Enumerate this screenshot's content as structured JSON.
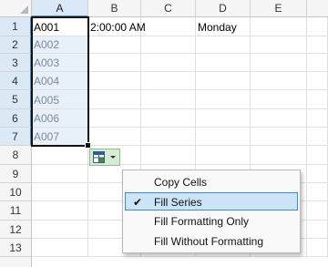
{
  "columns": [
    "A",
    "B",
    "C",
    "D",
    "E"
  ],
  "rows": [
    "1",
    "2",
    "3",
    "4",
    "5",
    "6",
    "7",
    "8",
    "9",
    "10",
    "11",
    "12",
    "13"
  ],
  "cells": {
    "a1": "A001",
    "a2": "A002",
    "a3": "A003",
    "a4": "A004",
    "a5": "A005",
    "a6": "A006",
    "a7": "A007",
    "b1": "2:00:00 AM",
    "d1": "Monday"
  },
  "autofill_menu": {
    "items": [
      "Copy Cells",
      "Fill Series",
      "Fill Formatting Only",
      "Fill Without Formatting"
    ],
    "checked_index": 1,
    "check_glyph": "✔"
  },
  "icons": {
    "autofill": "autofill-options-icon",
    "dropdown": "chevron-down-icon"
  },
  "colors": {
    "selection_header": "#dbe9f7",
    "menu_highlight": "#cce4f7",
    "autofill_button": "#d7ecd4"
  }
}
